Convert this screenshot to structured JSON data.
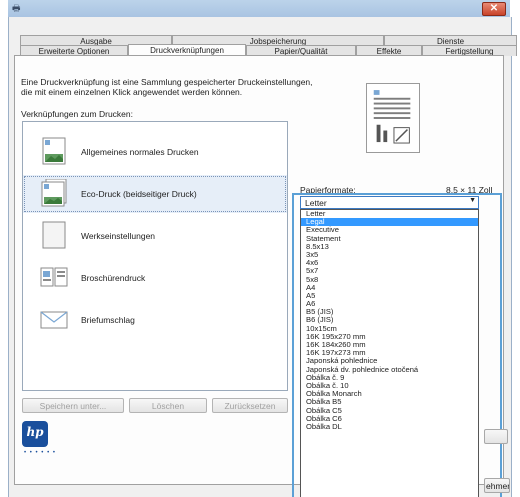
{
  "window": {
    "close_label": "✕"
  },
  "tabs_row1": [
    "Ausgabe",
    "Jobspeicherung",
    "Dienste"
  ],
  "tabs_row2": [
    "Erweiterte Optionen",
    "Druckverknüpfungen",
    "Papier/Qualität",
    "Effekte",
    "Fertigstellung"
  ],
  "active_tab": "Druckverknüpfungen",
  "description_line1": "Eine Druckverknüpfung ist eine Sammlung gespeicherter Druckeinstellungen,",
  "description_line2": "die mit einem einzelnen Klick angewendet werden können.",
  "shortcuts_label": "Verknüpfungen zum Drucken:",
  "shortcuts": [
    "Allgemeines normales Drucken",
    "Eco-Druck (beidseitiger Druck)",
    "Werkseinstellungen",
    "Broschürendruck",
    "Briefumschlag"
  ],
  "selected_shortcut": "Eco-Druck (beidseitiger Druck)",
  "buttons": {
    "save": "Speichern unter...",
    "delete": "Löschen",
    "reset": "Zurücksetzen",
    "edge_button": "ehmen"
  },
  "paper": {
    "label": "Papierformate:",
    "size_value": "8,5 × 11 Zoll",
    "selected": "Letter",
    "highlighted": "Legal",
    "options": [
      "Letter",
      "Legal",
      "Executive",
      "Statement",
      "8.5x13",
      "3x5",
      "4x6",
      "5x7",
      "5x8",
      "A4",
      "A5",
      "A6",
      "B5 (JIS)",
      "B6 (JIS)",
      "10x15cm",
      "16K 195x270 mm",
      "16K 184x260 mm",
      "16K 197x273 mm",
      "Japonská pohlednice",
      "Japonská dv. pohlednice otočená",
      "Obálka č. 9",
      "Obálka č. 10",
      "Obálka Monarch",
      "Obálka B5",
      "Obálka C5",
      "Obálka C6",
      "Obálka DL"
    ]
  },
  "colors": {
    "highlight": "#3399ff",
    "frame_accent": "#5ba0d6",
    "hp_blue": "#1a4f9c"
  },
  "logo_text": "hp",
  "logo_dots": "• • • • • •"
}
